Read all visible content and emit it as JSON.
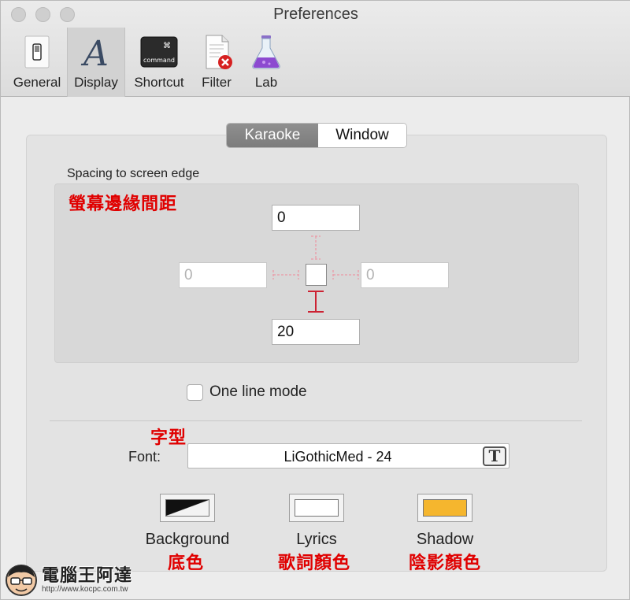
{
  "window": {
    "title": "Preferences"
  },
  "toolbar": {
    "items": [
      {
        "label": "General",
        "icon": "switch-icon"
      },
      {
        "label": "Display",
        "icon": "font-a-icon",
        "selected": true
      },
      {
        "label": "Shortcut",
        "icon": "command-key-icon"
      },
      {
        "label": "Filter",
        "icon": "document-remove-icon"
      },
      {
        "label": "Lab",
        "icon": "flask-icon"
      }
    ]
  },
  "tabs": {
    "active": "Karaoke",
    "inactive": "Window"
  },
  "spacing": {
    "label": "Spacing to screen edge",
    "annotation": "螢幕邊緣間距",
    "top": "0",
    "left": "0",
    "right": "0",
    "bottom": "20"
  },
  "one_line_mode": {
    "label": "One line mode",
    "checked": false
  },
  "font": {
    "annotation": "字型",
    "label": "Font:",
    "value": "LiGothicMed - 24"
  },
  "colors": {
    "background": {
      "label": "Background",
      "annotation": "底色"
    },
    "lyrics": {
      "label": "Lyrics",
      "annotation": "歌詞顏色",
      "color": "#ffffff"
    },
    "shadow": {
      "label": "Shadow",
      "annotation": "陰影顏色",
      "color": "#f5b62e"
    }
  },
  "watermark": {
    "name": "電腦王阿達",
    "url": "http://www.kocpc.com.tw"
  },
  "accent": {
    "annotation_red": "#e00000",
    "spacing_guide": "#cc2233"
  }
}
